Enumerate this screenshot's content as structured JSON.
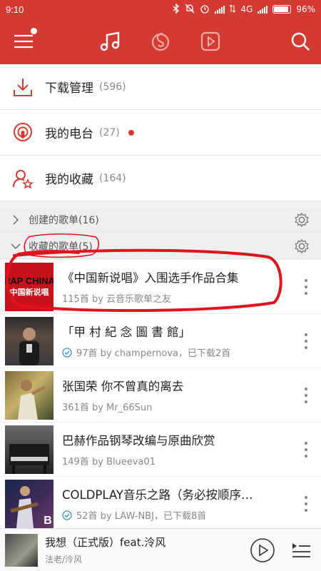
{
  "status_bar": {
    "time": "9:10",
    "network": "4G",
    "battery": "96%",
    "battery_level": 0.96
  },
  "header": {
    "tabs": [
      {
        "name": "music-note-icon",
        "active": true
      },
      {
        "name": "radio-icon",
        "active": false
      },
      {
        "name": "video-icon",
        "active": false
      }
    ]
  },
  "quick": {
    "items": [
      {
        "label": "下载管理",
        "count": "(596)",
        "icon": "download-icon"
      },
      {
        "label": "我的电台",
        "count": "(27)",
        "icon": "podcast-icon"
      },
      {
        "label": "我的收藏",
        "count": "(164)",
        "icon": "user-star-icon"
      }
    ]
  },
  "sections": {
    "created": {
      "title": "创建的歌单(16)"
    },
    "collected": {
      "title": "收藏的歌单(5)"
    }
  },
  "playlists": [
    {
      "title": "《中国新说唱》入围选手作品合集",
      "subtitle": "115首 by 云音乐歌单之友",
      "downloaded": false,
      "cover_text_top": "RAP CHINA",
      "cover_text_bottom": "中国新说唱"
    },
    {
      "title": "「甲 村 紀 念 圖 書 館」",
      "subtitle": "97首 by champernova，已下载2首",
      "downloaded": true
    },
    {
      "title": "张国荣 你不曾真的离去",
      "subtitle": "361首 by Mr_66Sun",
      "downloaded": false
    },
    {
      "title": "巴赫作品钢琴改编与原曲欣赏",
      "subtitle": "149首 by Blueeva01",
      "downloaded": false
    },
    {
      "title": "COLDPLAY音乐之路（务必按顺序…",
      "subtitle": "52首 by LAW-NBJ，已下载8首",
      "downloaded": true,
      "cover_badge": "B"
    }
  ],
  "player": {
    "title": "我想（正式版）feat.泠风",
    "artist": "法老/泠风"
  },
  "colors": {
    "brand": "#d33a31",
    "annotation": "#e0141e"
  }
}
